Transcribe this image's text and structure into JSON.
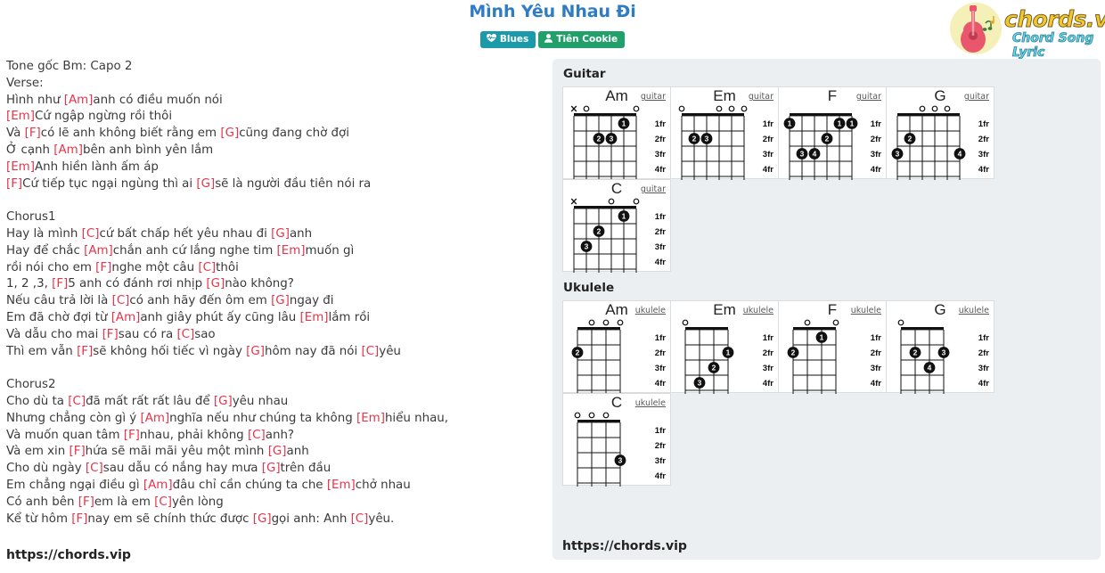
{
  "header": {
    "title": "Mình Yêu Nhau Đi",
    "badges": [
      {
        "label": "Blues",
        "icon": "heartbeat-icon",
        "color": "#1b9aaa"
      },
      {
        "label": "Tiên Cookie",
        "icon": "user-icon",
        "color": "#22a06b"
      }
    ],
    "logo": {
      "wordmark": "chords.vip",
      "tagline": "Chord Song Lyric",
      "icon": "guitar-icon"
    }
  },
  "lyrics": {
    "lines": [
      [
        {
          "t": "Tone gốc Bm: Capo 2",
          "c": false
        }
      ],
      [
        {
          "t": "Verse:",
          "c": false
        }
      ],
      [
        {
          "t": "Hình như ",
          "c": false
        },
        {
          "t": "[Am]",
          "c": true
        },
        {
          "t": "anh có điều muốn nói",
          "c": false
        }
      ],
      [
        {
          "t": "[Em]",
          "c": true
        },
        {
          "t": "Cứ ngập ngừng rồi thôi",
          "c": false
        }
      ],
      [
        {
          "t": "Và ",
          "c": false
        },
        {
          "t": "[F]",
          "c": true
        },
        {
          "t": "có lẽ anh không biết rằng em ",
          "c": false
        },
        {
          "t": "[G]",
          "c": true
        },
        {
          "t": "cũng đang chờ đợi",
          "c": false
        }
      ],
      [
        {
          "t": "Ở cạnh ",
          "c": false
        },
        {
          "t": "[Am]",
          "c": true
        },
        {
          "t": "bên anh bình yên lắm",
          "c": false
        }
      ],
      [
        {
          "t": "[Em]",
          "c": true
        },
        {
          "t": "Anh hiền lành ấm áp",
          "c": false
        }
      ],
      [
        {
          "t": "[F]",
          "c": true
        },
        {
          "t": "Cứ tiếp tục ngại ngùng thì ai ",
          "c": false
        },
        {
          "t": "[G]",
          "c": true
        },
        {
          "t": "sẽ là người đầu tiên nói ra",
          "c": false
        }
      ],
      [],
      [
        {
          "t": "Chorus1",
          "c": false
        }
      ],
      [
        {
          "t": "Hay là mình ",
          "c": false
        },
        {
          "t": "[C]",
          "c": true
        },
        {
          "t": "cứ bất chấp hết yêu nhau đi ",
          "c": false
        },
        {
          "t": "[G]",
          "c": true
        },
        {
          "t": "anh",
          "c": false
        }
      ],
      [
        {
          "t": "Hay để chắc ",
          "c": false
        },
        {
          "t": "[Am]",
          "c": true
        },
        {
          "t": "chắn anh cứ lắng nghe tim ",
          "c": false
        },
        {
          "t": "[Em]",
          "c": true
        },
        {
          "t": "muốn gì",
          "c": false
        }
      ],
      [
        {
          "t": "rồi nói cho em ",
          "c": false
        },
        {
          "t": "[F]",
          "c": true
        },
        {
          "t": "nghe một câu ",
          "c": false
        },
        {
          "t": "[C]",
          "c": true
        },
        {
          "t": "thôi",
          "c": false
        }
      ],
      [
        {
          "t": "1, 2 ,3, ",
          "c": false
        },
        {
          "t": "[F]",
          "c": true
        },
        {
          "t": "5 anh có đánh rơi nhịp ",
          "c": false
        },
        {
          "t": "[G]",
          "c": true
        },
        {
          "t": "nào không?",
          "c": false
        }
      ],
      [
        {
          "t": "Nếu câu trả lời là ",
          "c": false
        },
        {
          "t": "[C]",
          "c": true
        },
        {
          "t": "có anh hãy đến ôm em ",
          "c": false
        },
        {
          "t": "[G]",
          "c": true
        },
        {
          "t": "ngay đi",
          "c": false
        }
      ],
      [
        {
          "t": "Em đã chờ đợi từ ",
          "c": false
        },
        {
          "t": "[Am]",
          "c": true
        },
        {
          "t": "anh giây phút ấy cũng lâu ",
          "c": false
        },
        {
          "t": "[Em]",
          "c": true
        },
        {
          "t": "lắm rồi",
          "c": false
        }
      ],
      [
        {
          "t": "Và dẫu cho mai ",
          "c": false
        },
        {
          "t": "[F]",
          "c": true
        },
        {
          "t": "sau có ra ",
          "c": false
        },
        {
          "t": "[C]",
          "c": true
        },
        {
          "t": "sao",
          "c": false
        }
      ],
      [
        {
          "t": "Thì em vẫn ",
          "c": false
        },
        {
          "t": "[F]",
          "c": true
        },
        {
          "t": "sẽ không hối tiếc vì ngày ",
          "c": false
        },
        {
          "t": "[G]",
          "c": true
        },
        {
          "t": "hôm nay đã nói ",
          "c": false
        },
        {
          "t": "[C]",
          "c": true
        },
        {
          "t": "yêu",
          "c": false
        }
      ],
      [],
      [
        {
          "t": "Chorus2",
          "c": false
        }
      ],
      [
        {
          "t": "Cho dù ta ",
          "c": false
        },
        {
          "t": "[C]",
          "c": true
        },
        {
          "t": "đã mất rất rất lâu để ",
          "c": false
        },
        {
          "t": "[G]",
          "c": true
        },
        {
          "t": "yêu nhau",
          "c": false
        }
      ],
      [
        {
          "t": "Nhưng chẳng còn gì ý ",
          "c": false
        },
        {
          "t": "[Am]",
          "c": true
        },
        {
          "t": "nghĩa nếu như chúng ta không ",
          "c": false
        },
        {
          "t": "[Em]",
          "c": true
        },
        {
          "t": "hiểu nhau,",
          "c": false
        }
      ],
      [
        {
          "t": "Và muốn quan tâm ",
          "c": false
        },
        {
          "t": "[F]",
          "c": true
        },
        {
          "t": "nhau, phải không ",
          "c": false
        },
        {
          "t": "[C]",
          "c": true
        },
        {
          "t": "anh?",
          "c": false
        }
      ],
      [
        {
          "t": "Và em xin ",
          "c": false
        },
        {
          "t": "[F]",
          "c": true
        },
        {
          "t": "hứa sẽ mãi mãi yêu một mình ",
          "c": false
        },
        {
          "t": "[G]",
          "c": true
        },
        {
          "t": "anh",
          "c": false
        }
      ],
      [
        {
          "t": "Cho dù ngày ",
          "c": false
        },
        {
          "t": "[C]",
          "c": true
        },
        {
          "t": "sau dẫu có nắng hay mưa ",
          "c": false
        },
        {
          "t": "[G]",
          "c": true
        },
        {
          "t": "trên đầu",
          "c": false
        }
      ],
      [
        {
          "t": "Em chẳng ngại điều gì ",
          "c": false
        },
        {
          "t": "[Am]",
          "c": true
        },
        {
          "t": "đâu chỉ cần chúng ta che ",
          "c": false
        },
        {
          "t": "[Em]",
          "c": true
        },
        {
          "t": "chở nhau",
          "c": false
        }
      ],
      [
        {
          "t": "Có anh bên ",
          "c": false
        },
        {
          "t": "[F]",
          "c": true
        },
        {
          "t": "em là em ",
          "c": false
        },
        {
          "t": "[C]",
          "c": true
        },
        {
          "t": "yên lòng",
          "c": false
        }
      ],
      [
        {
          "t": "Kể từ hôm ",
          "c": false
        },
        {
          "t": "[F]",
          "c": true
        },
        {
          "t": "nay em sẽ chính thức được ",
          "c": false
        },
        {
          "t": "[G]",
          "c": true
        },
        {
          "t": "gọi anh: Anh ",
          "c": false
        },
        {
          "t": "[C]",
          "c": true
        },
        {
          "t": "yêu.",
          "c": false
        }
      ]
    ],
    "site_url": "https://chords.vip"
  },
  "panel": {
    "guitar_heading": "Guitar",
    "ukulele_heading": "Ukulele",
    "fret_labels": [
      "1fr",
      "2fr",
      "3fr",
      "4fr"
    ],
    "site_url": "https://chords.vip",
    "guitar_label": "guitar",
    "ukulele_label": "ukulele",
    "guitar_chords": [
      {
        "name": "Am",
        "instrument": "guitar",
        "strings": 6,
        "open": [
          {
            "string": 5,
            "mark": "x"
          },
          {
            "string": 4,
            "mark": "o"
          },
          {
            "string": 0,
            "mark": "o"
          }
        ],
        "dots": [
          {
            "string": 1,
            "fret": 1,
            "finger": "1"
          },
          {
            "string": 3,
            "fret": 2,
            "finger": "2"
          },
          {
            "string": 2,
            "fret": 2,
            "finger": "3"
          }
        ]
      },
      {
        "name": "Em",
        "instrument": "guitar",
        "strings": 6,
        "open": [
          {
            "string": 5,
            "mark": "o"
          },
          {
            "string": 2,
            "mark": "o"
          },
          {
            "string": 1,
            "mark": "o"
          },
          {
            "string": 0,
            "mark": "o"
          }
        ],
        "dots": [
          {
            "string": 4,
            "fret": 2,
            "finger": "2"
          },
          {
            "string": 3,
            "fret": 2,
            "finger": "3"
          }
        ]
      },
      {
        "name": "F",
        "instrument": "guitar",
        "strings": 6,
        "open": [],
        "dots": [
          {
            "string": 5,
            "fret": 1,
            "finger": "1"
          },
          {
            "string": 1,
            "fret": 1,
            "finger": "1"
          },
          {
            "string": 0,
            "fret": 1,
            "finger": "1"
          },
          {
            "string": 2,
            "fret": 2,
            "finger": "2"
          },
          {
            "string": 4,
            "fret": 3,
            "finger": "3"
          },
          {
            "string": 3,
            "fret": 3,
            "finger": "4"
          }
        ]
      },
      {
        "name": "G",
        "instrument": "guitar",
        "strings": 6,
        "open": [
          {
            "string": 3,
            "mark": "o"
          },
          {
            "string": 2,
            "mark": "o"
          },
          {
            "string": 1,
            "mark": "o"
          }
        ],
        "dots": [
          {
            "string": 4,
            "fret": 2,
            "finger": "2"
          },
          {
            "string": 5,
            "fret": 3,
            "finger": "3"
          },
          {
            "string": 0,
            "fret": 3,
            "finger": "4"
          }
        ]
      },
      {
        "name": "C",
        "instrument": "guitar",
        "strings": 6,
        "open": [
          {
            "string": 5,
            "mark": "x"
          },
          {
            "string": 2,
            "mark": "o"
          },
          {
            "string": 0,
            "mark": "o"
          }
        ],
        "dots": [
          {
            "string": 1,
            "fret": 1,
            "finger": "1"
          },
          {
            "string": 3,
            "fret": 2,
            "finger": "2"
          },
          {
            "string": 4,
            "fret": 3,
            "finger": "3"
          }
        ]
      }
    ],
    "ukulele_chords": [
      {
        "name": "Am",
        "instrument": "ukulele",
        "strings": 4,
        "open": [
          {
            "string": 2,
            "mark": "o"
          },
          {
            "string": 1,
            "mark": "o"
          },
          {
            "string": 0,
            "mark": "o"
          }
        ],
        "dots": [
          {
            "string": 3,
            "fret": 2,
            "finger": "2"
          }
        ]
      },
      {
        "name": "Em",
        "instrument": "ukulele",
        "strings": 4,
        "open": [
          {
            "string": 3,
            "mark": "o"
          }
        ],
        "dots": [
          {
            "string": 0,
            "fret": 2,
            "finger": "1"
          },
          {
            "string": 1,
            "fret": 3,
            "finger": "2"
          },
          {
            "string": 2,
            "fret": 4,
            "finger": "3"
          }
        ]
      },
      {
        "name": "F",
        "instrument": "ukulele",
        "strings": 4,
        "open": [
          {
            "string": 2,
            "mark": "o"
          },
          {
            "string": 0,
            "mark": "o"
          }
        ],
        "dots": [
          {
            "string": 1,
            "fret": 1,
            "finger": "1"
          },
          {
            "string": 3,
            "fret": 2,
            "finger": "2"
          }
        ]
      },
      {
        "name": "G",
        "instrument": "ukulele",
        "strings": 4,
        "open": [
          {
            "string": 3,
            "mark": "o"
          }
        ],
        "dots": [
          {
            "string": 2,
            "fret": 2,
            "finger": "2"
          },
          {
            "string": 0,
            "fret": 2,
            "finger": "3"
          },
          {
            "string": 1,
            "fret": 3,
            "finger": "4"
          }
        ]
      },
      {
        "name": "C",
        "instrument": "ukulele",
        "strings": 4,
        "open": [
          {
            "string": 3,
            "mark": "o"
          },
          {
            "string": 2,
            "mark": "o"
          },
          {
            "string": 1,
            "mark": "o"
          }
        ],
        "dots": [
          {
            "string": 0,
            "fret": 3,
            "finger": "3"
          }
        ]
      }
    ]
  }
}
